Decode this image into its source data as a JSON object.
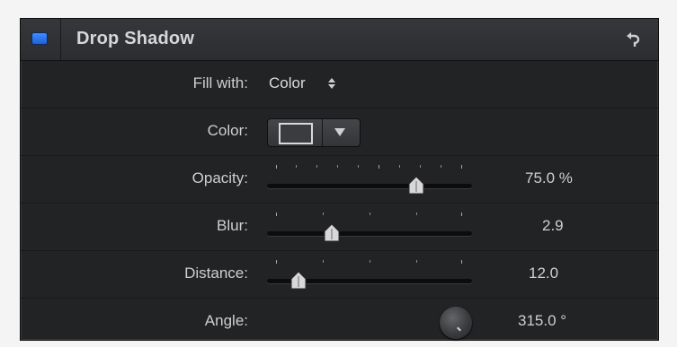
{
  "header": {
    "title": "Drop Shadow",
    "enabled": true,
    "check_color": "#2b74ee"
  },
  "fill_with": {
    "label": "Fill with:",
    "value": "Color"
  },
  "color": {
    "label": "Color:",
    "swatch_color": "#3b3c3f"
  },
  "opacity": {
    "label": "Opacity:",
    "value": "75.0  %",
    "level": 0.75
  },
  "blur": {
    "label": "Blur:",
    "value": "2.9"
  },
  "distance": {
    "label": "Distance:",
    "value": "12.0"
  },
  "angle": {
    "label": "Angle:",
    "value": "315.0  °"
  },
  "icons": {
    "reset": "reset-arrow-icon",
    "dropdown": "triangle-down-icon",
    "stepper": "up-down-arrows-icon"
  }
}
